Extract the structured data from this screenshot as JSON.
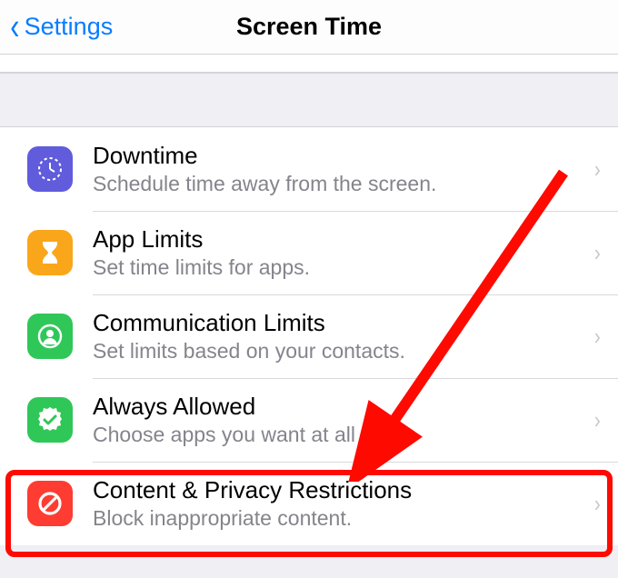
{
  "colors": {
    "link": "#097cff",
    "title": "#010101",
    "subtitle": "#84848c",
    "highlight": "#ff0a00",
    "downtime_icon": "#605cdb",
    "applimits_icon": "#faa61a",
    "commlimits_icon": "#30c759",
    "always_icon": "#30c759",
    "restrict_icon": "#fe3c31"
  },
  "header": {
    "back_label": "Settings",
    "title": "Screen Time"
  },
  "rows": {
    "downtime": {
      "title": "Downtime",
      "subtitle": "Schedule time away from the screen.",
      "icon": "downtime-icon"
    },
    "applimits": {
      "title": "App Limits",
      "subtitle": "Set time limits for apps.",
      "icon": "hourglass-icon"
    },
    "commlimits": {
      "title": "Communication Limits",
      "subtitle": "Set limits based on your contacts.",
      "icon": "contact-icon"
    },
    "always": {
      "title": "Always Allowed",
      "subtitle": "Choose apps you want at all times.",
      "icon": "checkbadge-icon"
    },
    "restrict": {
      "title": "Content & Privacy Restrictions",
      "subtitle": "Block inappropriate content.",
      "icon": "nosign-icon"
    }
  }
}
